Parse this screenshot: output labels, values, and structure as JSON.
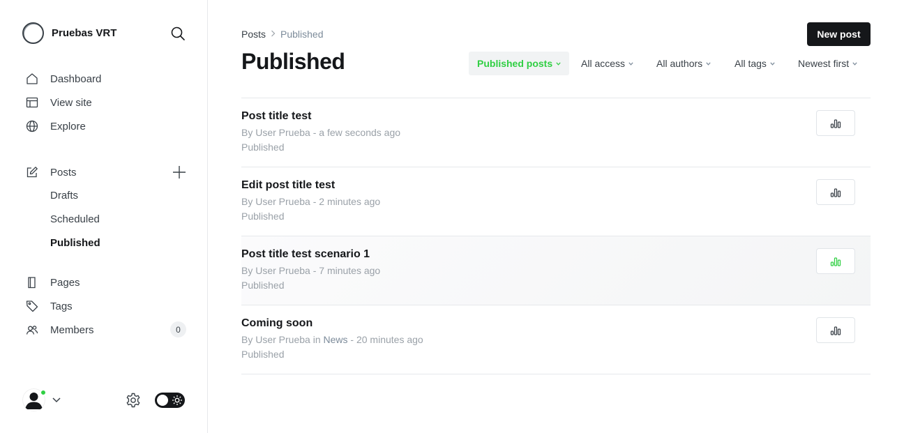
{
  "sidebar": {
    "brand": "Pruebas VRT",
    "nav": {
      "dashboard": "Dashboard",
      "view_site": "View site",
      "explore": "Explore",
      "posts": "Posts",
      "drafts": "Drafts",
      "scheduled": "Scheduled",
      "published": "Published",
      "pages": "Pages",
      "tags": "Tags",
      "members": "Members",
      "members_count": "0"
    }
  },
  "header": {
    "breadcrumb_parent": "Posts",
    "breadcrumb_current": "Published",
    "title": "Published",
    "new_post": "New post"
  },
  "filters": {
    "type": "Published posts",
    "access": "All access",
    "authors": "All authors",
    "tags": "All tags",
    "sort": "Newest first"
  },
  "posts": [
    {
      "title": "Post title test",
      "author": "By User Prueba",
      "tag_prefix": "",
      "tag": "",
      "time": " - a few seconds ago",
      "status": "Published"
    },
    {
      "title": "Edit post title test",
      "author": "By User Prueba",
      "tag_prefix": "",
      "tag": "",
      "time": " - 2 minutes ago",
      "status": "Published"
    },
    {
      "title": "Post title test scenario 1",
      "author": "By User Prueba",
      "tag_prefix": "",
      "tag": "",
      "time": " - 7 minutes ago",
      "status": "Published"
    },
    {
      "title": "Coming soon",
      "author": "By User Prueba",
      "tag_prefix": " in ",
      "tag": "News",
      "time": " - 20 minutes ago",
      "status": "Published"
    }
  ],
  "colors": {
    "accent_green": "#30cf43",
    "text_dark": "#15171a",
    "text_muted": "#9aa1a8"
  }
}
